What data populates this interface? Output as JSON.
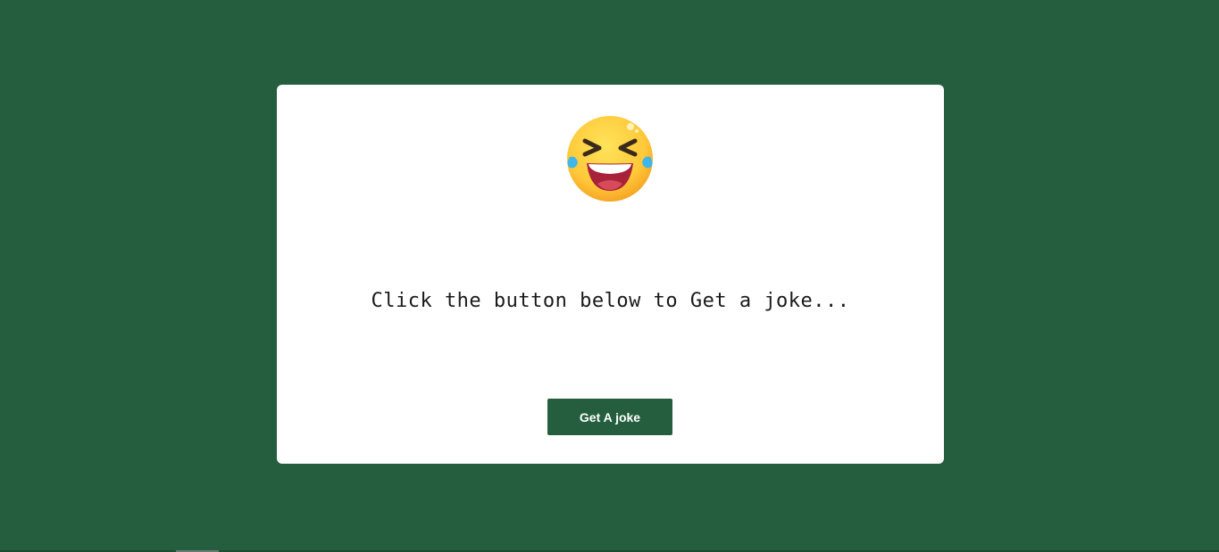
{
  "page": {
    "background_color": "#255e3e",
    "card_color": "#ffffff"
  },
  "card": {
    "emoji_icon": "laughing-tears-emoji-icon",
    "message": "Click the button below to Get a joke...",
    "button_label": "Get A joke",
    "button_color": "#255e3e"
  }
}
